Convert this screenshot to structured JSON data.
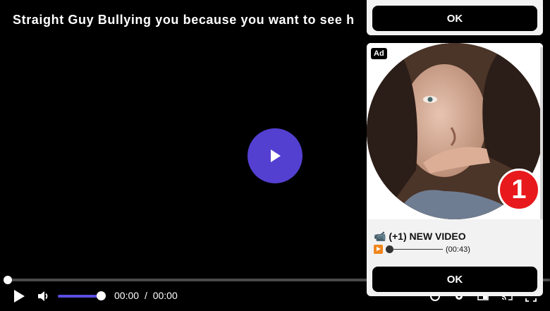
{
  "video": {
    "title": "Straight Guy Bullying you because you want to see h",
    "current_time": "00:00",
    "separator": "/",
    "duration": "00:00",
    "progress": 0,
    "volume": 1.0,
    "accent_color": "#5340d1"
  },
  "popup_top": {
    "ok_label": "OK"
  },
  "ad": {
    "badge": "Ad",
    "notification_count": "1",
    "title": "📹 (+1) NEW VIDEO",
    "sub_time": "(00:43)",
    "ok_label": "OK",
    "notification_color": "#e8191c"
  },
  "icons": [
    "play-icon",
    "volume-icon",
    "settings-icon",
    "gear-icon",
    "picture-in-picture-icon",
    "cast-icon",
    "fullscreen-icon"
  ]
}
